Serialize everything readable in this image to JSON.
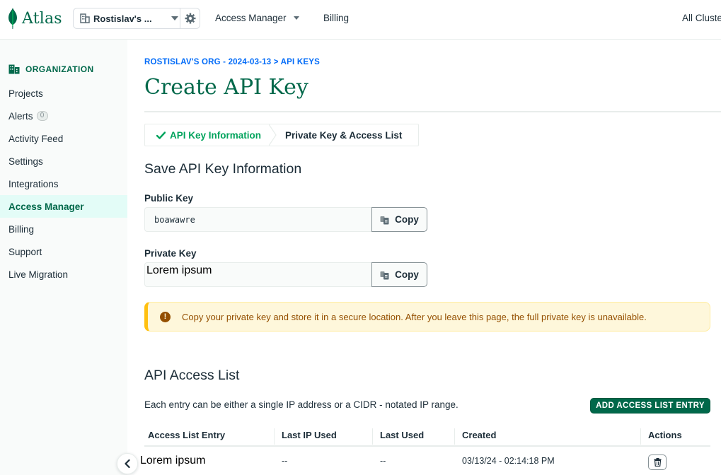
{
  "topbar": {
    "logo_text": "Atlas",
    "org_name": "Rostislav's ...",
    "nav": [
      {
        "label": "Access Manager"
      },
      {
        "label": "Billing"
      },
      {
        "label": "All Clusters"
      }
    ]
  },
  "sidebar": {
    "heading": "ORGANIZATION",
    "items": [
      {
        "label": "Projects"
      },
      {
        "label": "Alerts",
        "badge": "0"
      },
      {
        "label": "Activity Feed"
      },
      {
        "label": "Settings"
      },
      {
        "label": "Integrations"
      },
      {
        "label": "Access Manager",
        "active": true
      },
      {
        "label": "Billing"
      },
      {
        "label": "Support"
      },
      {
        "label": "Live Migration"
      }
    ]
  },
  "main": {
    "breadcrumb": "ROSTISLAV'S ORG - 2024-03-13 > API KEYS",
    "title": "Create API Key",
    "steps": [
      {
        "label": "API Key Information",
        "status": "complete"
      },
      {
        "label": "Private Key & Access List",
        "status": "current"
      }
    ],
    "save_section": {
      "heading": "Save API Key Information",
      "public_key": {
        "label": "Public Key",
        "value": "boawawre",
        "copy_label": "Copy"
      },
      "private_key": {
        "label": "Private Key",
        "value": "Lorem ipsum",
        "copy_label": "Copy"
      }
    },
    "warning": "Copy your private key and store it in a secure location. After you leave this page, the full private key is unavailable.",
    "access_list": {
      "heading": "API Access List",
      "description": "Each entry can be either a single IP address or a CIDR - notated IP range.",
      "add_button": "ADD ACCESS LIST ENTRY",
      "columns": [
        "Access List Entry",
        "Last IP Used",
        "Last Used",
        "Created",
        "Actions"
      ],
      "rows": [
        {
          "entry": "Lorem ipsum",
          "last_ip": "--",
          "last_used": "--",
          "created": "03/13/24 - 02:14:18 PM"
        }
      ]
    }
  },
  "colors": {
    "brand_green": "#00684a",
    "link_blue": "#016bf8",
    "step_complete": "#00a35c",
    "warning_bg": "#fef7db",
    "warning_text": "#944f01"
  }
}
